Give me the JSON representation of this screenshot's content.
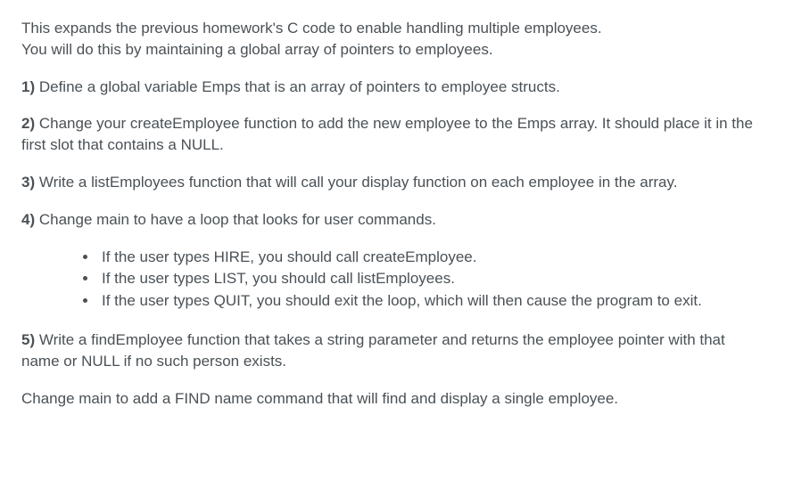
{
  "intro": {
    "line1": "This expands the previous homework's C code to enable handling multiple employees.",
    "line2": "You will do this by maintaining a global array of pointers to employees."
  },
  "items": {
    "one": {
      "num": "1)",
      "text": " Define a global variable Emps that is an array of pointers to employee structs."
    },
    "two": {
      "num": "2)",
      "text": " Change your createEmployee function to add the new employee to the Emps array. It should place it in the first slot that contains a NULL."
    },
    "three": {
      "num": "3)",
      "text": " Write a listEmployees function that will call your display function on each employee in the array."
    },
    "four": {
      "num": "4)",
      "text": " Change main to have a loop that looks for user commands."
    },
    "five": {
      "num": "5)",
      "text": " Write a findEmployee function that takes a string parameter and returns the employee pointer with that name or NULL if no such person exists."
    }
  },
  "bullets": {
    "hire": "If the user types HIRE, you should call createEmployee.",
    "list": "If the user types LIST, you should call listEmployees.",
    "quit": "If the user types QUIT, you should exit the loop, which will then cause the program to exit."
  },
  "closing": "Change main to add a FIND name command that will find and display a single employee."
}
